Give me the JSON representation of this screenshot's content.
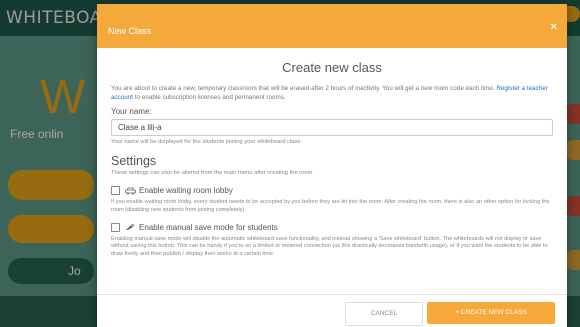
{
  "background": {
    "logo": "WHITEBOARD",
    "hero_letter": "W",
    "tagline": "Free onlin",
    "join_button": "Jo"
  },
  "modal": {
    "header_title": "New Class",
    "close_glyph": "×",
    "heading": "Create new class",
    "intro_before_link": "You are about to create a new, temporary classroom that will be erased after 2 hours of inactivity. You will get a new room code each time.",
    "intro_link": "Register a teacher account",
    "intro_after_link": "to enable subscription licenses and permanent rooms.",
    "name_label": "Your name:",
    "name_value": "Clase a lili-a",
    "name_help": "Your name will be displayed for the students joining your whiteboard class.",
    "settings_title": "Settings",
    "settings_note": "These settings can also be altered from the main menu after creating the room.",
    "options": [
      {
        "icon": "car-icon",
        "label": "Enable waiting room lobby",
        "description": "If you enable waiting room lobby, every student needs to be accepted by you before they are let into the room. After creating the room, there is also an other option for locking the room (disabling new students from joining completely).",
        "checked": false
      },
      {
        "icon": "manual-save-icon",
        "label": "Enable manual save mode for students",
        "description": "Enabling manual save mode will disable the automatic whiteboard save functionality, and instead showing a 'Save whiteboard' button. The whiteboards will not display or save without saving this button. This can be handy if you're on a limited or metered connection (as this drastically decreases bandwith usage), or if you want the students to be able to draw freely and then publish / display their works at a certain time.",
        "checked": false
      }
    ],
    "cancel_label": "CANCEL",
    "create_label": "+ CREATE NEW CLASS"
  },
  "colors": {
    "header_orange": "#f4a93a",
    "primary_button": "#f6a83a",
    "link_blue": "#1a73c9",
    "background_green": "#1f5b4d"
  }
}
